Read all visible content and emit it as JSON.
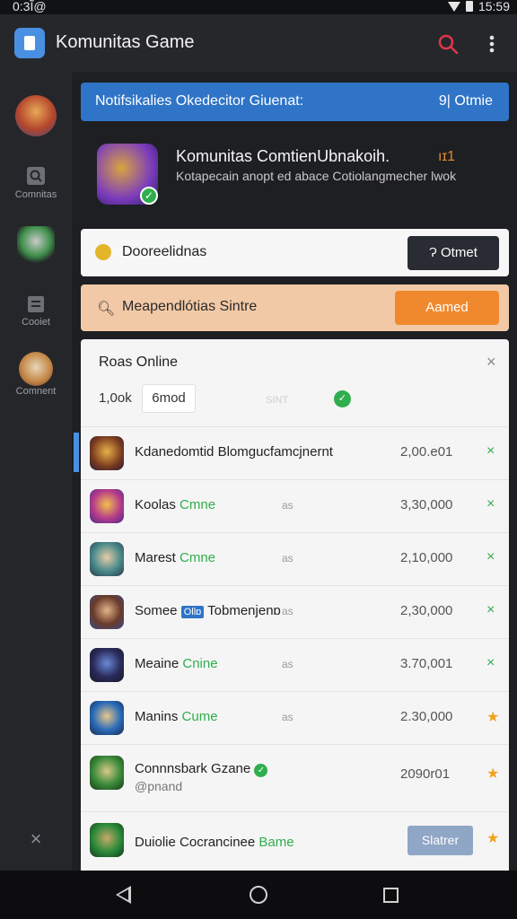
{
  "status": {
    "time": "0:3Ĩ@",
    "clock_right": "15:59"
  },
  "appbar": {
    "title": "Komunitas Game",
    "search_icon": "search-icon",
    "menu_icon": "more-vert-icon",
    "accent": "#e0364b"
  },
  "sidebar": {
    "items": [
      {
        "label": "",
        "icon": "game-avatar-icon"
      },
      {
        "label": "Comnitas",
        "icon": "search-icon"
      },
      {
        "label": "",
        "icon": "character-icon"
      },
      {
        "label": "Cooiet",
        "icon": "document-icon"
      },
      {
        "label": "Comnent",
        "icon": "warrior-icon"
      }
    ],
    "close_label": "×"
  },
  "banner": {
    "left": "Notifsikalies Okedecitor Giuenat:",
    "right": "9| Otmie"
  },
  "feature": {
    "title": "Komunitas ComtienUbnakoih.",
    "title_badge": "ıɪ1",
    "subtitle": "Kotapecain anopt ed abace Cotiolangmecher lwok"
  },
  "card_one": {
    "label": "Dooreelidnas",
    "button": "Ɂ Otmet"
  },
  "card_two": {
    "label": "Meapendlótias Sintre",
    "button": "Aamed"
  },
  "panel": {
    "title": "Roas Online",
    "count": "1,0ok",
    "chip": "6mod",
    "faint": "SINT",
    "rows": [
      {
        "name": "Kdanedomtid Blomgucfamcjnernt",
        "highlight": "",
        "tag": "",
        "sub": "",
        "value": "2,00.e01",
        "action": "×"
      },
      {
        "name": "Koolas ",
        "highlight": "Cmne",
        "tag": "",
        "sub": "as",
        "value": "3,30,000",
        "action": "×"
      },
      {
        "name": "Marest ",
        "highlight": "Cmne",
        "tag": "",
        "sub": "as",
        "value": "2,10,000",
        "action": "×"
      },
      {
        "name": "Somee ",
        "highlight": "",
        "tag": "Ollɒ",
        "tail": " Tobmenjenɒ",
        "sub": "as",
        "value": "2,30,000",
        "action": "×"
      },
      {
        "name": "Meaine ",
        "highlight": "Cnine",
        "tag": "",
        "sub": "as",
        "value": "3.70,001",
        "action": "×"
      },
      {
        "name": "Manins ",
        "highlight": "Cume",
        "tag": "",
        "sub": "as",
        "value": "2.30,000",
        "action": "★"
      },
      {
        "name": "Connnsbark Gzane",
        "highlight": "",
        "tag": "",
        "sub": "",
        "value": "2090r01",
        "action": "★",
        "line2": "@pnand"
      },
      {
        "name": "Duiolie Cocrancinee ",
        "highlight": "Bame",
        "tag": "",
        "sub": "",
        "value": "",
        "button": "Slatrer",
        "action": "★"
      }
    ]
  }
}
